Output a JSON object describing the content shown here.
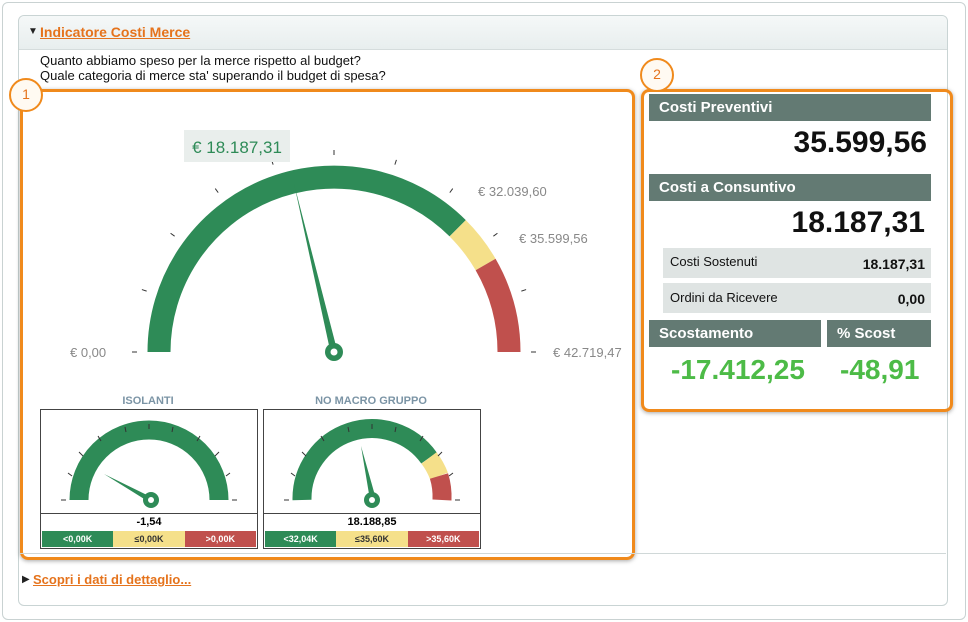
{
  "panel": {
    "title": "Indicatore Costi Merce",
    "question1": "Quanto abbiamo speso per la merce rispetto al budget?",
    "question2": "Quale categoria di merce sta' superando il budget di spesa?",
    "details_link": "Scopri i dati di dettaglio..."
  },
  "badges": [
    "1",
    "2"
  ],
  "main_gauge": {
    "value_label": "€ 18.187,31",
    "value": 18187.31,
    "min_label": "€ 0,00",
    "max_label": "€ 42.719,47",
    "threshold1_label": "€ 32.039,60",
    "threshold2_label": "€ 35.599,56",
    "min": 0,
    "max": 42719.47,
    "threshold1": 32039.6,
    "threshold2": 35599.56
  },
  "mini_gauges": [
    {
      "title": "ISOLANTI",
      "value_label": "-1,54",
      "legend": [
        "<0,00K",
        "≤0,00K",
        ">0,00K"
      ]
    },
    {
      "title": "NO MACRO GRUPPO",
      "value_label": "18.188,85",
      "legend": [
        "<32,04K",
        "≤35,60K",
        ">35,60K"
      ]
    }
  ],
  "summary": {
    "preventivi_label": "Costi Preventivi",
    "preventivi_value": "35.599,56",
    "consuntivo_label": "Costi a Consuntivo",
    "consuntivo_value": "18.187,31",
    "sostenuti_label": "Costi Sostenuti",
    "sostenuti_value": "18.187,31",
    "ordini_label": "Ordini da Ricevere",
    "ordini_value": "0,00",
    "scostamento_label": "Scostamento",
    "scostamento_value": "-17.412,25",
    "pct_label": "% Scost",
    "pct_value": "-48,91"
  },
  "colors": {
    "green": "#2e8b57",
    "yellow": "#f5e08a",
    "red": "#c0504d",
    "accent_orange": "#f08a1c",
    "header_bar": "#637a73",
    "positive_text": "#4dbb47"
  }
}
